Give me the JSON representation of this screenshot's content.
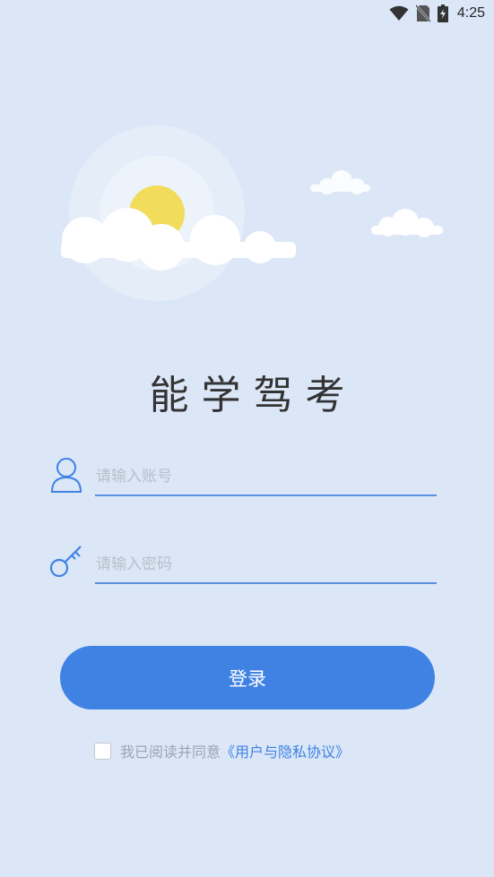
{
  "status_bar": {
    "time": "4:25",
    "icons": [
      "wifi-icon",
      "no-sim-icon",
      "battery-charging-icon"
    ]
  },
  "app": {
    "title": "能学驾考"
  },
  "form": {
    "account_placeholder": "请输入账号",
    "password_placeholder": "请输入密码",
    "login_label": "登录"
  },
  "agreement": {
    "prefix": "我已阅读并同意",
    "link": "《用户与隐私协议》",
    "checked": false
  },
  "colors": {
    "background": "#dbe7f7",
    "accent": "#3f82e4",
    "sun": "#f2dc5c"
  }
}
